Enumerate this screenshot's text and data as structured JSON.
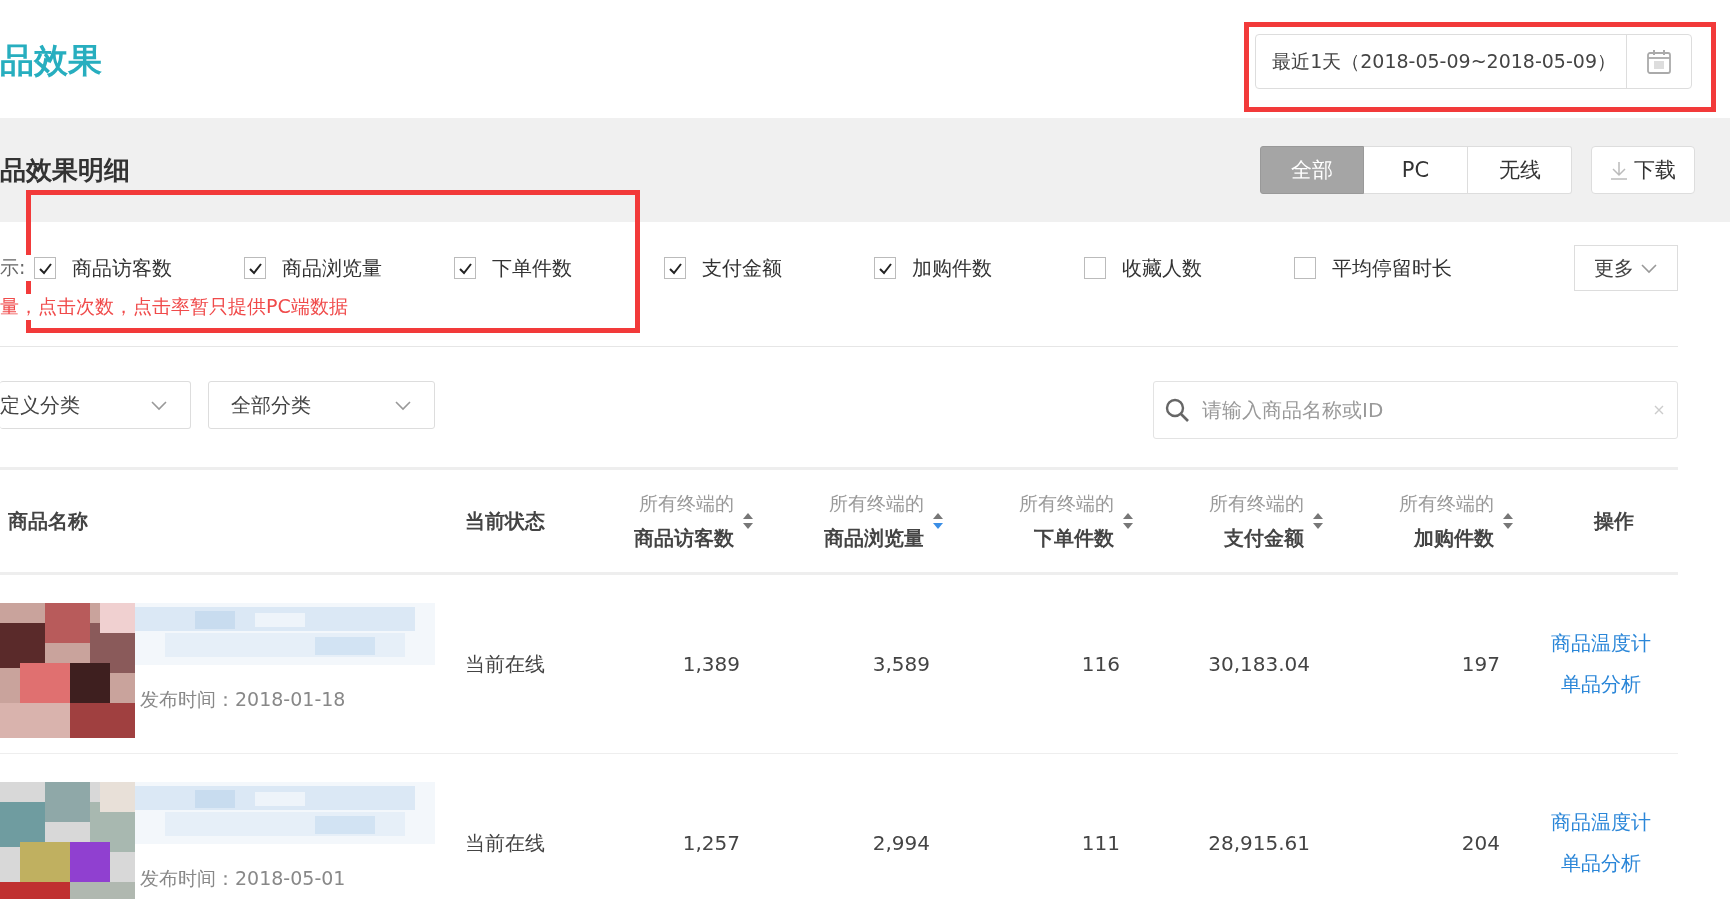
{
  "page_title": "品效果",
  "date_range": {
    "value": "最近1天（2018-05-09~2018-05-09）"
  },
  "section_title": "品效果明细",
  "terminal_tabs": [
    {
      "label": "全部",
      "selected": true
    },
    {
      "label": "PC",
      "selected": false
    },
    {
      "label": "无线",
      "selected": false
    }
  ],
  "download_button": "下载",
  "metrics_label": "示:",
  "metrics": [
    {
      "label": "商品访客数",
      "checked": true
    },
    {
      "label": "商品浏览量",
      "checked": true
    },
    {
      "label": "下单件数",
      "checked": true
    },
    {
      "label": "支付金额",
      "checked": true
    },
    {
      "label": "加购件数",
      "checked": true
    },
    {
      "label": "收藏人数",
      "checked": false
    },
    {
      "label": "平均停留时长",
      "checked": false
    }
  ],
  "more_button": "更多",
  "notice": "量，点击次数，点击率暂只提供PC端数据",
  "filters": [
    {
      "value": "定义分类"
    },
    {
      "value": "全部分类"
    }
  ],
  "search": {
    "placeholder": "请输入商品名称或ID"
  },
  "table": {
    "columns": [
      {
        "kind": "plain",
        "label": "商品名称"
      },
      {
        "kind": "plain",
        "label": "当前状态"
      },
      {
        "kind": "metric",
        "caption": "所有终端的",
        "label": "商品访客数",
        "sorted": false
      },
      {
        "kind": "metric",
        "caption": "所有终端的",
        "label": "商品浏览量",
        "sorted": true
      },
      {
        "kind": "metric",
        "caption": "所有终端的",
        "label": "下单件数",
        "sorted": false
      },
      {
        "kind": "metric",
        "caption": "所有终端的",
        "label": "支付金额",
        "sorted": false
      },
      {
        "kind": "metric",
        "caption": "所有终端的",
        "label": "加购件数",
        "sorted": false
      },
      {
        "kind": "action",
        "label": "操作"
      }
    ],
    "rows": [
      {
        "thumbnail": {
          "kind": "picture"
        },
        "title_image": {
          "kind": "picture"
        },
        "published": "发布时间：2018-01-18",
        "status": "当前在线",
        "values": [
          "1,389",
          "3,589",
          "116",
          "30,183.04",
          "197"
        ],
        "actions": [
          "商品温度计",
          "单品分析"
        ]
      },
      {
        "thumbnail": {
          "kind": "picture"
        },
        "title_image": {
          "kind": "picture"
        },
        "published": "发布时间：2018-05-01",
        "status": "当前在线",
        "values": [
          "1,257",
          "2,994",
          "111",
          "28,915.61",
          "204"
        ],
        "actions": [
          "商品温度计",
          "单品分析"
        ]
      }
    ]
  }
}
